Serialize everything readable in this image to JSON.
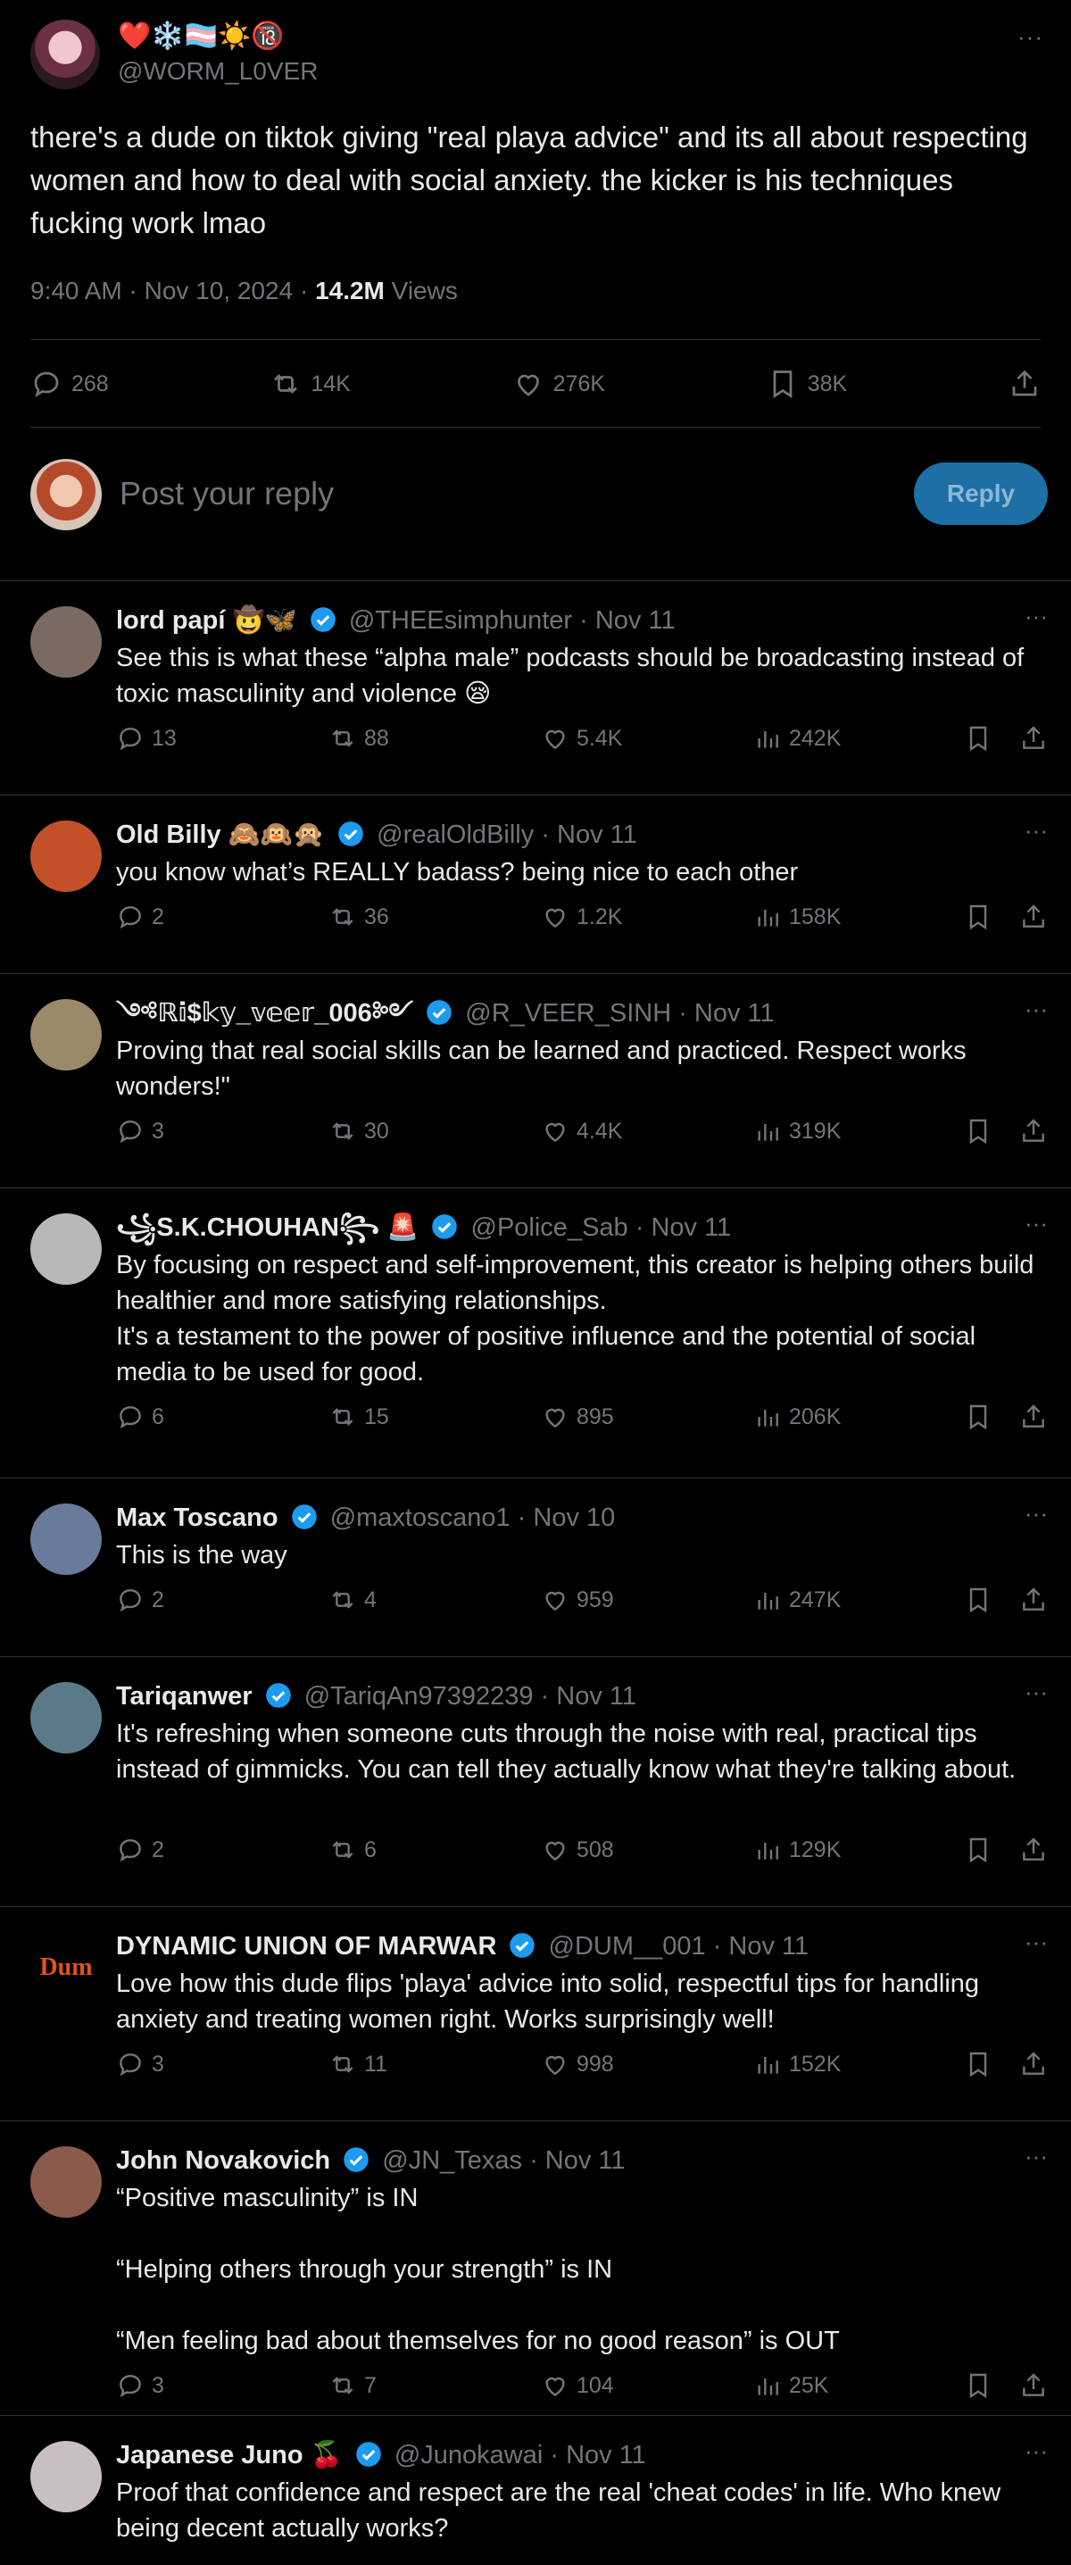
{
  "main_tweet": {
    "emojis": "❤️❄️🏳️‍⚧️☀️🔞",
    "handle": "@WORM_L0VER",
    "more": "···",
    "text": "there's a dude on tiktok giving \"real playa advice\" and its all about respecting women and how to deal with social anxiety. the kicker is his techniques fucking work lmao",
    "time": "9:40 AM · Nov 10, 2024 · ",
    "views_count": "14.2M",
    "views_label": " Views",
    "replies": "268",
    "reposts": "14K",
    "likes": "276K",
    "bookmarks": "38K"
  },
  "composer": {
    "placeholder": "Post your reply",
    "button": "Reply"
  },
  "replies": [
    {
      "name": "lord papí 🤠🦋",
      "meta": "@THEEsimphunter · Nov 11",
      "text": "See this is what these “alpha male” podcasts should be broadcasting instead of toxic masculinity and violence 😪",
      "replies": "13",
      "reposts": "88",
      "likes": "5.4K",
      "views": "242K",
      "avatar": "#7a6a60"
    },
    {
      "name": "Old Billy 🙈🙉🙊",
      "meta": "@realOldBilly · Nov 11",
      "text": "you know what’s REALLY badass? being nice to each other",
      "replies": "2",
      "reposts": "36",
      "likes": "1.2K",
      "views": "158K",
      "avatar": "#c4502a"
    },
    {
      "name": "༺ℝ𝕚$𝕜𝕪_𝕧𝕖𝕖𝕣_006༻",
      "meta": "@R_VEER_SINH · Nov 11",
      "text": "Proving that real social skills can be learned and practiced. Respect works wonders!\"",
      "replies": "3",
      "reposts": "30",
      "likes": "4.4K",
      "views": "319K",
      "avatar": "#9a8a6a"
    },
    {
      "name": "꧁S.K.CHOUHAN꧂ 🚨",
      "meta": "@Police_Sab · Nov 11",
      "text": "By focusing on respect and self-improvement, this creator is helping others build healthier and more satisfying relationships.\nIt's a testament to the power of positive influence and the potential of social media to be used for good.",
      "replies": "6",
      "reposts": "15",
      "likes": "895",
      "views": "206K",
      "avatar": "#b8b8b8"
    },
    {
      "name": "Max Toscano",
      "meta": "@maxtoscano1 · Nov 10",
      "text": "This is the way",
      "replies": "2",
      "reposts": "4",
      "likes": "959",
      "views": "247K",
      "avatar": "#6a7a9a"
    },
    {
      "name": "Tariqanwer",
      "meta": "@TariqAn97392239 · Nov 11",
      "text": "It's refreshing when someone cuts through the noise with real, practical tips instead of gimmicks. You can tell they actually know what they're talking about.",
      "replies": "2",
      "reposts": "6",
      "likes": "508",
      "views": "129K",
      "avatar": "#5a7a8a"
    },
    {
      "name": "DYNAMIC UNION OF MARWAR",
      "meta": "@DUM__001 · Nov 11",
      "text": "Love how this dude flips 'playa' advice into solid, respectful tips for handling anxiety and treating women right. Works surprisingly well!",
      "replies": "3",
      "reposts": "11",
      "likes": "998",
      "views": "152K",
      "avatar": "#000000",
      "logo": "Dum"
    },
    {
      "name": "John Novakovich",
      "meta": "@JN_Texas · Nov 11",
      "text": "“Positive masculinity” is IN\n\n“Helping others through your strength” is IN\n\n“Men feeling bad about themselves for no good reason” is OUT",
      "replies": "3",
      "reposts": "7",
      "likes": "104",
      "views": "25K",
      "avatar": "#8a5a4a"
    },
    {
      "name": "Japanese Juno 🍒",
      "meta": "@Junokawai · Nov 11",
      "text": "Proof that confidence and respect are the real 'cheat codes' in life. Who knew being decent actually works?",
      "replies": "",
      "reposts": "",
      "likes": "",
      "views": "",
      "avatar": "#c8c0c0"
    }
  ],
  "colors": {
    "verified": "#1d9bf0",
    "muted": "#71767b",
    "text": "#e7e9ea",
    "divider": "#2f3336",
    "reply_button": "#1d6fa5"
  }
}
